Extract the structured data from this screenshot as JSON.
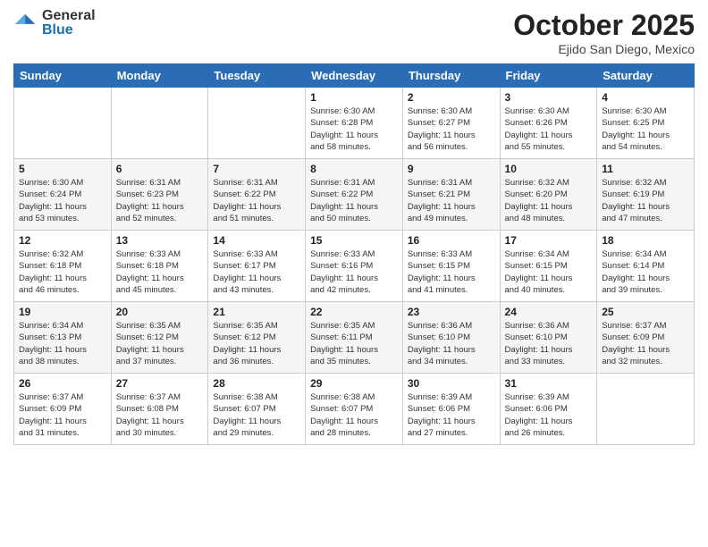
{
  "header": {
    "logo_general": "General",
    "logo_blue": "Blue",
    "month_title": "October 2025",
    "location": "Ejido San Diego, Mexico"
  },
  "weekdays": [
    "Sunday",
    "Monday",
    "Tuesday",
    "Wednesday",
    "Thursday",
    "Friday",
    "Saturday"
  ],
  "weeks": [
    [
      {
        "day": "",
        "info": ""
      },
      {
        "day": "",
        "info": ""
      },
      {
        "day": "",
        "info": ""
      },
      {
        "day": "1",
        "info": "Sunrise: 6:30 AM\nSunset: 6:28 PM\nDaylight: 11 hours\nand 58 minutes."
      },
      {
        "day": "2",
        "info": "Sunrise: 6:30 AM\nSunset: 6:27 PM\nDaylight: 11 hours\nand 56 minutes."
      },
      {
        "day": "3",
        "info": "Sunrise: 6:30 AM\nSunset: 6:26 PM\nDaylight: 11 hours\nand 55 minutes."
      },
      {
        "day": "4",
        "info": "Sunrise: 6:30 AM\nSunset: 6:25 PM\nDaylight: 11 hours\nand 54 minutes."
      }
    ],
    [
      {
        "day": "5",
        "info": "Sunrise: 6:30 AM\nSunset: 6:24 PM\nDaylight: 11 hours\nand 53 minutes."
      },
      {
        "day": "6",
        "info": "Sunrise: 6:31 AM\nSunset: 6:23 PM\nDaylight: 11 hours\nand 52 minutes."
      },
      {
        "day": "7",
        "info": "Sunrise: 6:31 AM\nSunset: 6:22 PM\nDaylight: 11 hours\nand 51 minutes."
      },
      {
        "day": "8",
        "info": "Sunrise: 6:31 AM\nSunset: 6:22 PM\nDaylight: 11 hours\nand 50 minutes."
      },
      {
        "day": "9",
        "info": "Sunrise: 6:31 AM\nSunset: 6:21 PM\nDaylight: 11 hours\nand 49 minutes."
      },
      {
        "day": "10",
        "info": "Sunrise: 6:32 AM\nSunset: 6:20 PM\nDaylight: 11 hours\nand 48 minutes."
      },
      {
        "day": "11",
        "info": "Sunrise: 6:32 AM\nSunset: 6:19 PM\nDaylight: 11 hours\nand 47 minutes."
      }
    ],
    [
      {
        "day": "12",
        "info": "Sunrise: 6:32 AM\nSunset: 6:18 PM\nDaylight: 11 hours\nand 46 minutes."
      },
      {
        "day": "13",
        "info": "Sunrise: 6:33 AM\nSunset: 6:18 PM\nDaylight: 11 hours\nand 45 minutes."
      },
      {
        "day": "14",
        "info": "Sunrise: 6:33 AM\nSunset: 6:17 PM\nDaylight: 11 hours\nand 43 minutes."
      },
      {
        "day": "15",
        "info": "Sunrise: 6:33 AM\nSunset: 6:16 PM\nDaylight: 11 hours\nand 42 minutes."
      },
      {
        "day": "16",
        "info": "Sunrise: 6:33 AM\nSunset: 6:15 PM\nDaylight: 11 hours\nand 41 minutes."
      },
      {
        "day": "17",
        "info": "Sunrise: 6:34 AM\nSunset: 6:15 PM\nDaylight: 11 hours\nand 40 minutes."
      },
      {
        "day": "18",
        "info": "Sunrise: 6:34 AM\nSunset: 6:14 PM\nDaylight: 11 hours\nand 39 minutes."
      }
    ],
    [
      {
        "day": "19",
        "info": "Sunrise: 6:34 AM\nSunset: 6:13 PM\nDaylight: 11 hours\nand 38 minutes."
      },
      {
        "day": "20",
        "info": "Sunrise: 6:35 AM\nSunset: 6:12 PM\nDaylight: 11 hours\nand 37 minutes."
      },
      {
        "day": "21",
        "info": "Sunrise: 6:35 AM\nSunset: 6:12 PM\nDaylight: 11 hours\nand 36 minutes."
      },
      {
        "day": "22",
        "info": "Sunrise: 6:35 AM\nSunset: 6:11 PM\nDaylight: 11 hours\nand 35 minutes."
      },
      {
        "day": "23",
        "info": "Sunrise: 6:36 AM\nSunset: 6:10 PM\nDaylight: 11 hours\nand 34 minutes."
      },
      {
        "day": "24",
        "info": "Sunrise: 6:36 AM\nSunset: 6:10 PM\nDaylight: 11 hours\nand 33 minutes."
      },
      {
        "day": "25",
        "info": "Sunrise: 6:37 AM\nSunset: 6:09 PM\nDaylight: 11 hours\nand 32 minutes."
      }
    ],
    [
      {
        "day": "26",
        "info": "Sunrise: 6:37 AM\nSunset: 6:09 PM\nDaylight: 11 hours\nand 31 minutes."
      },
      {
        "day": "27",
        "info": "Sunrise: 6:37 AM\nSunset: 6:08 PM\nDaylight: 11 hours\nand 30 minutes."
      },
      {
        "day": "28",
        "info": "Sunrise: 6:38 AM\nSunset: 6:07 PM\nDaylight: 11 hours\nand 29 minutes."
      },
      {
        "day": "29",
        "info": "Sunrise: 6:38 AM\nSunset: 6:07 PM\nDaylight: 11 hours\nand 28 minutes."
      },
      {
        "day": "30",
        "info": "Sunrise: 6:39 AM\nSunset: 6:06 PM\nDaylight: 11 hours\nand 27 minutes."
      },
      {
        "day": "31",
        "info": "Sunrise: 6:39 AM\nSunset: 6:06 PM\nDaylight: 11 hours\nand 26 minutes."
      },
      {
        "day": "",
        "info": ""
      }
    ]
  ]
}
